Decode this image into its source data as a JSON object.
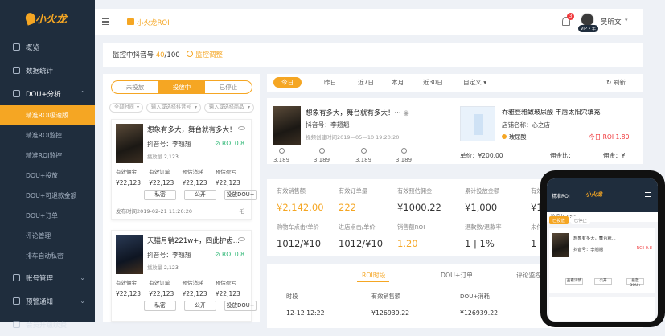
{
  "sidebar": {
    "logo": "小火龙",
    "items": [
      {
        "label": "概览",
        "icon": "overview-icon"
      },
      {
        "label": "数据统计",
        "icon": "stats-icon"
      },
      {
        "label": "DOU+分析",
        "icon": "analysis-icon",
        "expanded": true
      }
    ],
    "sub_items": [
      "精准ROI极速版",
      "精准ROI监控",
      "精准ROI监控",
      "DOU+投放",
      "DOU+可退款金额",
      "DOU+订单",
      "评论管理",
      "排车自动私密"
    ],
    "more_items": [
      {
        "label": "账号管理",
        "icon": "account-icon"
      },
      {
        "label": "预警通知",
        "icon": "alert-icon"
      },
      {
        "label": "会员升级续费",
        "icon": "vip-icon"
      }
    ]
  },
  "topbar": {
    "title": "小火龙ROI",
    "bell_count": "3",
    "vip_label": "VIP • 年",
    "user_name": "吴昕文"
  },
  "monitor": {
    "label": "监控中抖音号",
    "used": "40",
    "total": "/100",
    "adjust": "监控调整"
  },
  "left": {
    "segments": [
      "未投放",
      "投放中",
      "已停止"
    ],
    "filters": [
      "全部时间",
      "输入或选择抖音号",
      "输入或选择商品"
    ],
    "cards": [
      {
        "title": "想象有多大，舞台就有多大！",
        "account": "抖音号：李翘翘",
        "roi": "ROI 0.8",
        "play_label": "播放量",
        "play": "2,123",
        "cols": [
          "有效佣金",
          "有效订单",
          "预估消耗",
          "预估盈亏"
        ],
        "vals": [
          "¥22,123",
          "¥22,123",
          "¥22,123",
          "¥22,123"
        ],
        "buttons": [
          "私密",
          "公开",
          "投放DOU+"
        ],
        "published": "发布时间2019-02-21 11:20:20",
        "extra": "乇"
      },
      {
        "title": "天猫月销221w+，四此护齿...",
        "account": "抖音号：李翘翘",
        "roi": "ROI 0.8",
        "play_label": "播放量",
        "play": "2,123",
        "cols": [
          "有效佣金",
          "有效订单",
          "预估消耗",
          "预估盈亏"
        ],
        "vals": [
          "¥22,123",
          "¥22,123",
          "¥22,123",
          "¥22,123"
        ],
        "buttons": [
          "私密",
          "公开",
          "投放DOU+"
        ]
      }
    ]
  },
  "right": {
    "tabs": [
      "今日",
      "昨日",
      "近7日",
      "本月",
      "近30日",
      "自定义"
    ],
    "refresh": "刷新",
    "video": {
      "title": "想象有多大，舞台就有多大！···",
      "account": "抖音号：李翘翘",
      "time": "视频创建时间2019—05—10 19:20:20",
      "stats": [
        "3,189",
        "3,189",
        "3,189",
        "3,189"
      ]
    },
    "product": {
      "title": "乔雅登雅致玻尿酸 丰唇太阳穴填充",
      "shop": "店铺名称：心之店",
      "tag": "玻尿酸",
      "roi": "今日 ROI 1.80",
      "price": "单价：¥200.00",
      "commission": "佣金比：",
      "commission2": "佣金：¥"
    },
    "metrics": [
      {
        "label": "有效销售额",
        "value": "¥2,142.00",
        "orange": true
      },
      {
        "label": "有效订单量",
        "value": "222",
        "orange": true
      },
      {
        "label": "有效预估佣金",
        "value": "¥1000.22"
      },
      {
        "label": "累计投放金额",
        "value": "¥1,000"
      },
      {
        "label": "有效",
        "value": "¥1"
      },
      {
        "label": "购物车点击/单价",
        "value": "1012/¥10"
      },
      {
        "label": "进店点击/单价",
        "value": "1012/¥10"
      },
      {
        "label": "销售额ROI",
        "value": "1.20",
        "orange": true
      },
      {
        "label": "退款数/退款率",
        "value": "1 | 1%"
      },
      {
        "label": "未付款",
        "value": "1"
      }
    ],
    "detail": {
      "tabs": [
        "ROI时段",
        "DOU+订单",
        "评论监控"
      ],
      "headers": [
        "时段",
        "有效销售额",
        "DOU+消耗"
      ],
      "row": [
        "12-12 12:22",
        "¥126939.22",
        "¥126939.22"
      ]
    }
  },
  "phone": {
    "title": "精准ROI",
    "logo": "小火龙",
    "monitor": "监控中 2/50",
    "segments": [
      "已投放",
      "已停止"
    ],
    "card_title": "想象有多大，舞台就...",
    "card_account": "抖音号：李翘翘",
    "card_roi": "ROI 0.8",
    "buttons": [
      "查看详情",
      "公开",
      "投放DOU+"
    ]
  }
}
